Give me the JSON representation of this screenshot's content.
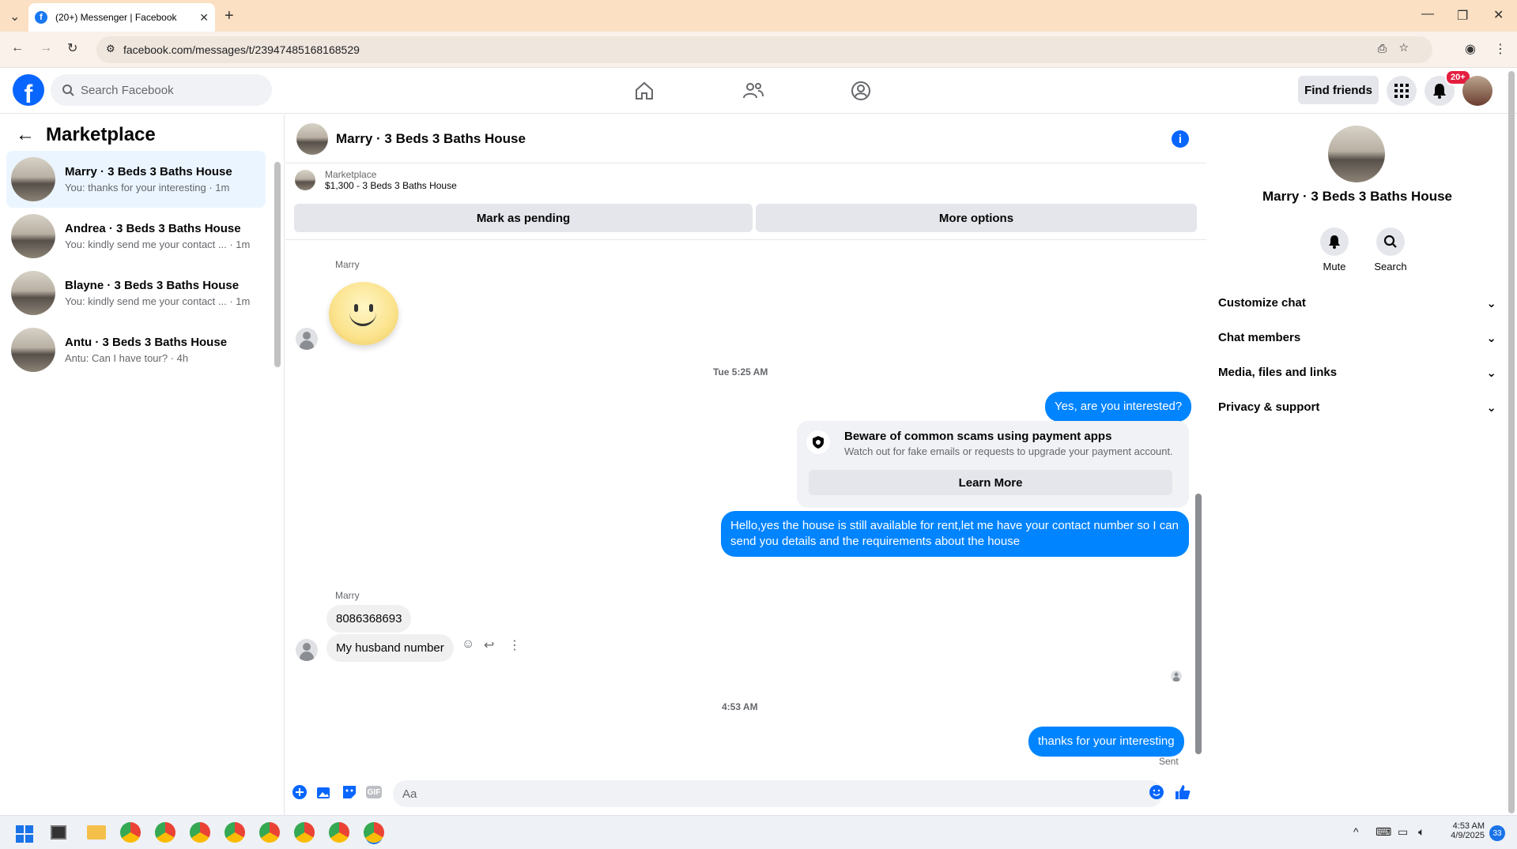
{
  "browser": {
    "tab_title": "(20+) Messenger | Facebook",
    "url": "facebook.com/messages/t/23947485168168529"
  },
  "fb": {
    "search_placeholder": "Search Facebook",
    "find_friends": "Find friends",
    "notif_badge": "20+"
  },
  "left": {
    "title": "Marketplace",
    "conversations": [
      {
        "name": "Marry · 3 Beds 3 Baths House",
        "preview": "You: thanks for your interesting · 1m"
      },
      {
        "name": "Andrea · 3 Beds 3 Baths House",
        "preview": "You: kindly send me your contact ... · 1m"
      },
      {
        "name": "Blayne · 3 Beds 3 Baths House",
        "preview": "You: kindly send me your contact ... · 1m"
      },
      {
        "name": "Antu · 3 Beds 3 Baths House",
        "preview": "Antu: Can I have tour? · 4h"
      }
    ]
  },
  "chat": {
    "title": "Marry · 3 Beds 3 Baths House",
    "marketplace_label": "Marketplace",
    "listing": "$1,300 - 3 Beds 3 Baths House",
    "mark_pending": "Mark as pending",
    "more_options": "More options",
    "sender_name_1": "Marry",
    "timestamp_1": "Tue 5:25 AM",
    "msg_interested": "Yes, are you interested?",
    "scam_title": "Beware of common scams using payment apps",
    "scam_sub": "Watch out for fake emails or requests to upgrade your payment account.",
    "learn_more": "Learn More",
    "msg_hello": "Hello,yes the house is still available for rent,let me have your contact number   so I can send you details and the requirements about the house",
    "sender_name_2": "Marry",
    "msg_number": "8086368693",
    "msg_husband": "My husband number",
    "timestamp_2": "4:53 AM",
    "msg_thanks": "thanks for your interesting",
    "sent_label": "Sent",
    "composer_placeholder": "Aa"
  },
  "right": {
    "name": "Marry · 3 Beds 3 Baths House",
    "mute": "Mute",
    "search": "Search",
    "sections": [
      "Customize chat",
      "Chat members",
      "Media, files and links",
      "Privacy & support"
    ]
  },
  "taskbar": {
    "time": "4:53 AM",
    "date": "4/9/2025",
    "notif_count": "33"
  }
}
